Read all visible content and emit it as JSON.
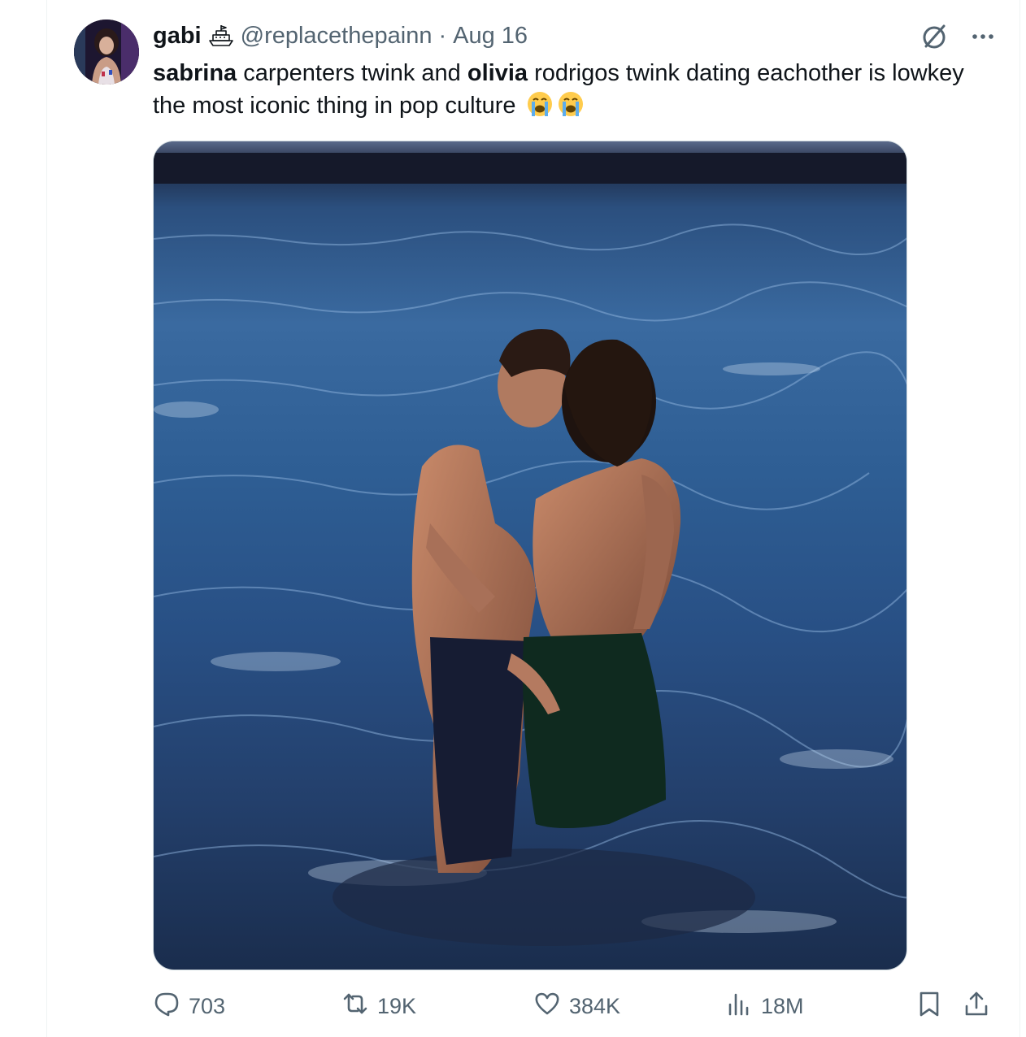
{
  "tweet": {
    "author_name": "gabi",
    "handle": "@replacethepainn",
    "separator": "·",
    "date": "Aug 16",
    "text_parts": {
      "p1_bold": "sabrina",
      "p2": " carpenters twink and ",
      "p3_bold": "olivia",
      "p4": " rodrigos twink dating eachother is lowkey the most iconic thing in pop culture"
    },
    "emoji": [
      "loudly-crying-face",
      "loudly-crying-face"
    ],
    "media": {
      "icon": "photo"
    }
  },
  "actions": {
    "replies": "703",
    "reposts": "19K",
    "likes": "384K",
    "views": "18M"
  },
  "icons": {
    "badge": "ship-icon",
    "grok": "grok-icon",
    "more": "more-icon",
    "reply": "reply-icon",
    "repost": "repost-icon",
    "like": "heart-icon",
    "views": "views-icon",
    "bookmark": "bookmark-icon",
    "share": "share-icon"
  },
  "colors": {
    "text": "#0f1419",
    "secondary": "#536471",
    "border": "#cfd9de"
  }
}
